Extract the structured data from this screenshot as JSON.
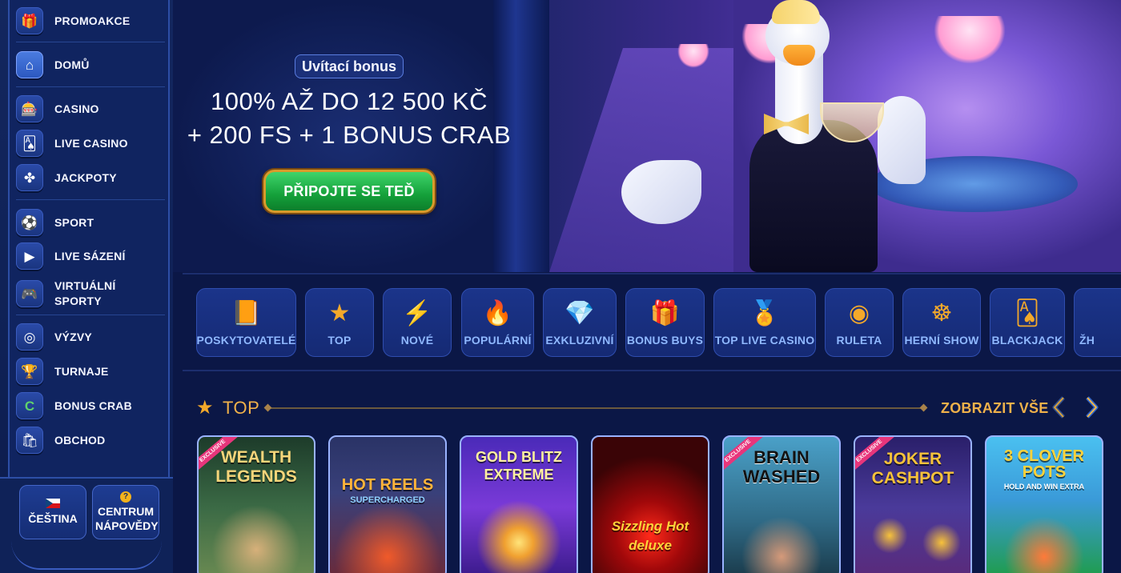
{
  "sidebar": {
    "items": [
      {
        "label": "PROMOAKCE",
        "icon": "gift-icon",
        "glyph": "🎁"
      },
      {
        "label": "DOMŮ",
        "icon": "home-icon",
        "glyph": "⌂"
      },
      {
        "label": "CASINO",
        "icon": "slot-machine-icon",
        "glyph": "🎰"
      },
      {
        "label": "LIVE CASINO",
        "icon": "live-cards-icon",
        "glyph": "🂡"
      },
      {
        "label": "JACKPOTY",
        "icon": "clover-icon",
        "glyph": "✤"
      },
      {
        "label": "SPORT",
        "icon": "ball-icon",
        "glyph": "⚽"
      },
      {
        "label": "LIVE SÁZENÍ",
        "icon": "play-icon",
        "glyph": "▶"
      },
      {
        "label": "VIRTUÁLNÍ SPORTY",
        "icon": "gamepad-icon",
        "glyph": "🎮"
      },
      {
        "label": "VÝZVY",
        "icon": "target-icon",
        "glyph": "◎"
      },
      {
        "label": "TURNAJE",
        "icon": "trophy-icon",
        "glyph": "🏆"
      },
      {
        "label": "BONUS CRAB",
        "icon": "crab-icon",
        "glyph": "C"
      },
      {
        "label": "OBCHOD",
        "icon": "shop-bag-icon",
        "glyph": "🛍"
      }
    ],
    "language_label": "ČEŠTINA",
    "help_label": "CENTRUM NÁPOVĚDY"
  },
  "hero": {
    "badge": "Uvítací bonus",
    "title_line1": "100% AŽ DO 12 500 KČ",
    "title_line2": "+ 200 FS + 1 BONUS CRAB",
    "cta": "PŘIPOJTE SE TEĎ"
  },
  "categories": [
    {
      "label": "POSKYTOVATELÉ",
      "icon": "book-icon",
      "glyph": "📙"
    },
    {
      "label": "TOP",
      "icon": "star-icon",
      "glyph": "★"
    },
    {
      "label": "NOVÉ",
      "icon": "lightning-icon",
      "glyph": "⚡"
    },
    {
      "label": "POPULÁRNÍ",
      "icon": "fire-icon",
      "glyph": "🔥"
    },
    {
      "label": "EXKLUZIVNÍ",
      "icon": "diamond-icon",
      "glyph": "💎"
    },
    {
      "label": "BONUS BUYS",
      "icon": "gift-box-icon",
      "glyph": "🎁"
    },
    {
      "label": "TOP LIVE CASINO",
      "icon": "medal-icon",
      "glyph": "🏅"
    },
    {
      "label": "RULETA",
      "icon": "roulette-icon",
      "glyph": "◉"
    },
    {
      "label": "HERNÍ SHOW",
      "icon": "wheel-icon",
      "glyph": "☸"
    },
    {
      "label": "BLACKJACK",
      "icon": "cards-icon",
      "glyph": "🂡"
    },
    {
      "label": "ŽH",
      "icon": "more-icon",
      "glyph": ""
    }
  ],
  "top_section": {
    "title": "TOP",
    "see_all": "ZOBRAZIT VŠE"
  },
  "games": [
    {
      "title": "WEALTH LEGENDS",
      "exclusive": "EXCLUSIVE",
      "bg": "#2f5a3a",
      "fg": "#f6d57a"
    },
    {
      "title": "HOT REELS",
      "sub": "SUPERCHARGED",
      "bg": "#27325a",
      "fg": "#ffb43a"
    },
    {
      "title": "GOLD BLITZ EXTREME",
      "bg": "#5a2fb0",
      "fg": "#fff1a0"
    },
    {
      "title": "Sizzling Hot deluxe",
      "bg": "#6b0e12",
      "fg": "#ff3a2a"
    },
    {
      "title": "BRAIN WASHED",
      "exclusive": "EXCLUSIVE",
      "bg": "#2f6a86",
      "fg": "#111111"
    },
    {
      "title": "JOKER CASHPOT",
      "exclusive": "EXCLUSIVE",
      "bg": "#3a2f7a",
      "fg": "#f7c23a"
    },
    {
      "title": "3 CLOVER POTS",
      "sub": "HOLD AND WIN EXTRA",
      "bg": "#1f9c4a",
      "fg": "#ffd23a"
    }
  ]
}
